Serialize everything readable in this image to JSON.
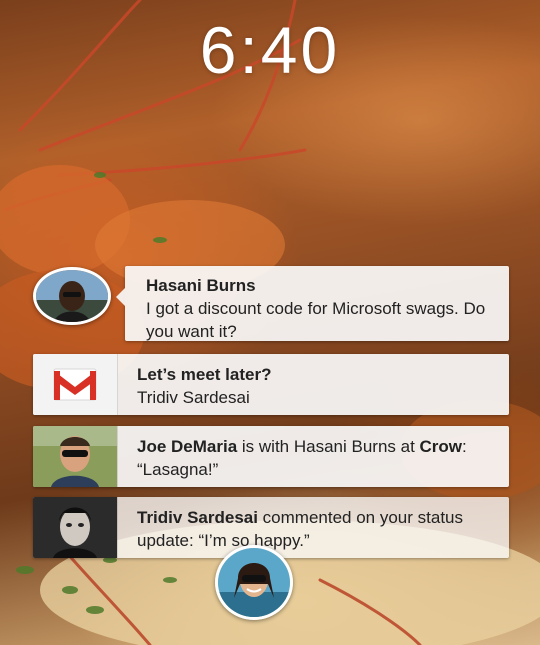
{
  "lockscreen": {
    "time": "6:40"
  },
  "chathead_message": {
    "sender": "Hasani Burns",
    "message": "I got a discount code for Microsoft swags. Do you want it?"
  },
  "notifications": [
    {
      "icon": "gmail-icon",
      "title": "Let’s meet later?",
      "subtitle": "Tridiv Sardesai"
    },
    {
      "icon": "profile-photo",
      "actor": "Joe DeMaria",
      "text_1": " is with Hasani Burns at ",
      "place": "Crow",
      "text_2": ": “Lasagna!”"
    },
    {
      "icon": "profile-photo",
      "actor": "Tridiv Sardesai",
      "text_1": " commented on your status update: “I’m so happy.”"
    }
  ],
  "colors": {
    "card_background": "#fafafa",
    "gmail_red": "#d93025",
    "text": "#222222"
  }
}
